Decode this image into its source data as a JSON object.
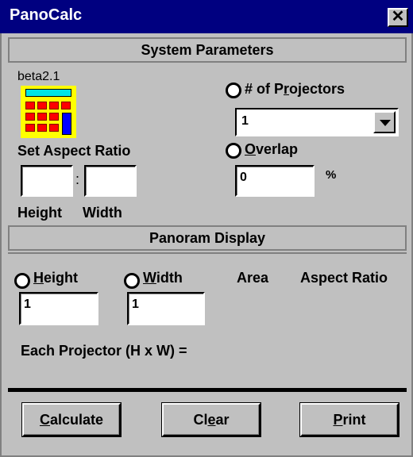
{
  "window": {
    "title": "PanoCalc",
    "close_glyph": "✕"
  },
  "system": {
    "header": "System Parameters",
    "version": "beta2.1",
    "aspect_label": "Set Aspect Ratio",
    "aspect_height_value": "",
    "aspect_width_value": "",
    "aspect_separator": ":",
    "height_label": "Height",
    "width_label": "Width",
    "projectors": {
      "label_prefix": "# of P",
      "label_ul": "r",
      "label_suffix": "ojectors",
      "selected": "1"
    },
    "overlap": {
      "label_ul": "O",
      "label_suffix": "verlap",
      "value": "0",
      "unit": "%"
    }
  },
  "panoram": {
    "header": "Panoram Display",
    "height": {
      "label_ul": "H",
      "label_suffix": "eight",
      "value": "1"
    },
    "width": {
      "label_ul": "W",
      "label_suffix": "idth",
      "value": "1"
    },
    "area_label": "Area",
    "aspect_ratio_label": "Aspect Ratio",
    "each_projector_label": "Each Projector (H x W) ="
  },
  "buttons": {
    "calculate": {
      "ul": "C",
      "rest": "alculate"
    },
    "clear": {
      "pre": "Cl",
      "ul": "e",
      "rest": "ar"
    },
    "print": {
      "ul": "P",
      "rest": "rint"
    }
  },
  "colors": {
    "titlebar": "#000080",
    "face": "#c0c0c0",
    "calc_body": "#ffff00",
    "calc_keys": "#ff0000",
    "calc_screen": "#00e5e5",
    "calc_big_key": "#0000ff"
  }
}
